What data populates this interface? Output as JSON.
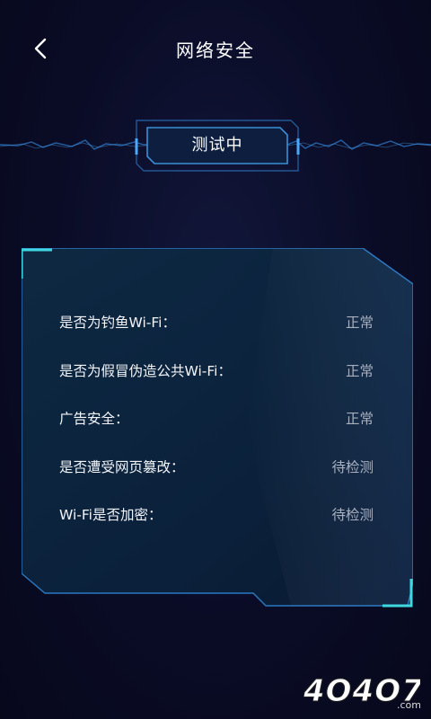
{
  "header": {
    "title": "网络安全",
    "back_icon": "chevron-left-icon"
  },
  "status": {
    "label": "测试中"
  },
  "checks": [
    {
      "label": "是否为钓鱼Wi-Fi：",
      "value": "正常"
    },
    {
      "label": "是否为假冒伪造公共Wi-Fi：",
      "value": "正常"
    },
    {
      "label": "广告安全：",
      "value": "正常"
    },
    {
      "label": "是否遭受网页篡改：",
      "value": "待检测"
    },
    {
      "label": "Wi-Fi是否加密：",
      "value": "待检测"
    }
  ],
  "watermark": {
    "text": "4O4O7",
    "suffix": ".com"
  },
  "colors": {
    "background": "#0a0c26",
    "accent": "#3a8fd6",
    "corner_accent": "#3fd8e0",
    "value_text": "#a8b0c0"
  }
}
